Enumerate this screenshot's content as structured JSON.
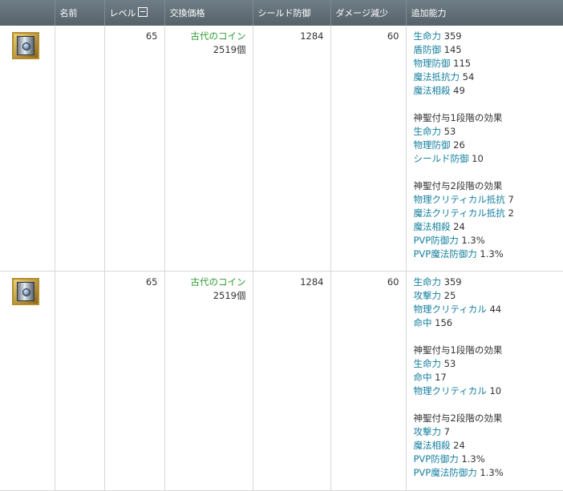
{
  "header": {
    "name": "名前",
    "level": "レベル",
    "price": "交換価格",
    "shield_defense": "シールド防御",
    "damage_reduction": "ダメージ減少",
    "extra_ability": "追加能力"
  },
  "rows": [
    {
      "icon": "shield-icon",
      "level": "65",
      "price_coin": "古代のコイン",
      "price_qty": "2519個",
      "shield_defense": "1284",
      "damage_reduction": "60",
      "base": [
        {
          "name": "生命力",
          "value": "359"
        },
        {
          "name": "盾防御",
          "value": "145"
        },
        {
          "name": "物理防御",
          "value": "115"
        },
        {
          "name": "魔法抵抗力",
          "value": "54"
        },
        {
          "name": "魔法相殺",
          "value": "49"
        }
      ],
      "tier1_heading": "神聖付与1段階の効果",
      "tier1": [
        {
          "name": "生命力",
          "value": "53"
        },
        {
          "name": "物理防御",
          "value": "26"
        },
        {
          "name": "シールド防御",
          "value": "10"
        }
      ],
      "tier2_heading": "神聖付与2段階の効果",
      "tier2": [
        {
          "name": "物理クリティカル抵抗",
          "value": "7"
        },
        {
          "name": "魔法クリティカル抵抗",
          "value": "2"
        },
        {
          "name": "魔法相殺",
          "value": "24"
        },
        {
          "name": "PVP防御力",
          "value": "1.3%"
        },
        {
          "name": "PVP魔法防御力",
          "value": "1.3%"
        }
      ]
    },
    {
      "icon": "shield-icon",
      "level": "65",
      "price_coin": "古代のコイン",
      "price_qty": "2519個",
      "shield_defense": "1284",
      "damage_reduction": "60",
      "base": [
        {
          "name": "生命力",
          "value": "359"
        },
        {
          "name": "攻撃力",
          "value": "25"
        },
        {
          "name": "物理クリティカル",
          "value": "44"
        },
        {
          "name": "命中",
          "value": "156"
        }
      ],
      "tier1_heading": "神聖付与1段階の効果",
      "tier1": [
        {
          "name": "生命力",
          "value": "53"
        },
        {
          "name": "命中",
          "value": "17"
        },
        {
          "name": "物理クリティカル",
          "value": "10"
        }
      ],
      "tier2_heading": "神聖付与2段階の効果",
      "tier2": [
        {
          "name": "攻撃力",
          "value": "7"
        },
        {
          "name": "魔法相殺",
          "value": "24"
        },
        {
          "name": "PVP防御力",
          "value": "1.3%"
        },
        {
          "name": "PVP魔法防御力",
          "value": "1.3%"
        }
      ]
    }
  ]
}
